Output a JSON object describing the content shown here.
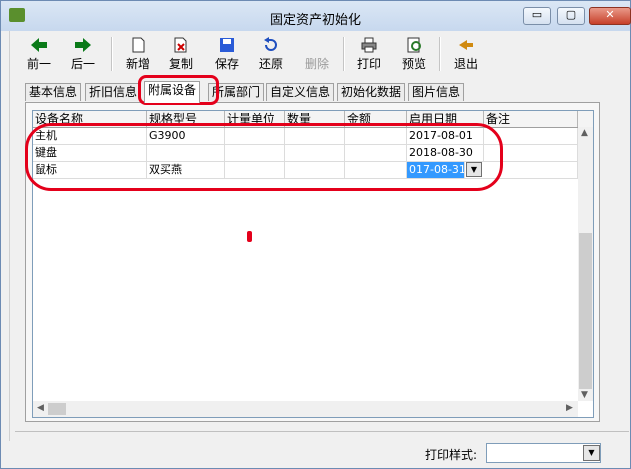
{
  "window": {
    "title": "固定资产初始化",
    "minimize": "▭",
    "maximize": "▢",
    "close": "✕"
  },
  "toolbar": {
    "prev": "前一",
    "next": "后一",
    "add": "新增",
    "copy": "复制",
    "save": "保存",
    "restore": "还原",
    "delete": "删除",
    "print": "打印",
    "preview": "预览",
    "exit": "退出"
  },
  "tabs": [
    "基本信息",
    "折旧信息",
    "附属设备",
    "所属部门",
    "自定义信息",
    "初始化数据",
    "图片信息"
  ],
  "grid": {
    "columns": [
      "设备名称",
      "规格型号",
      "计量单位",
      "数量",
      "金额",
      "启用日期",
      "备注"
    ],
    "rows": [
      [
        "主机",
        "G3900",
        "",
        "",
        "",
        "2017-08-01",
        ""
      ],
      [
        "键盘",
        "",
        "",
        "",
        "",
        "2018-08-30",
        ""
      ],
      [
        "鼠标",
        "双买燕",
        "",
        "",
        "",
        "017-08-31",
        ""
      ]
    ]
  },
  "footer": {
    "print_style_label": "打印样式:",
    "print_style_value": ""
  },
  "colors": {
    "annotation": "#e4001b",
    "selection": "#3399ff"
  }
}
